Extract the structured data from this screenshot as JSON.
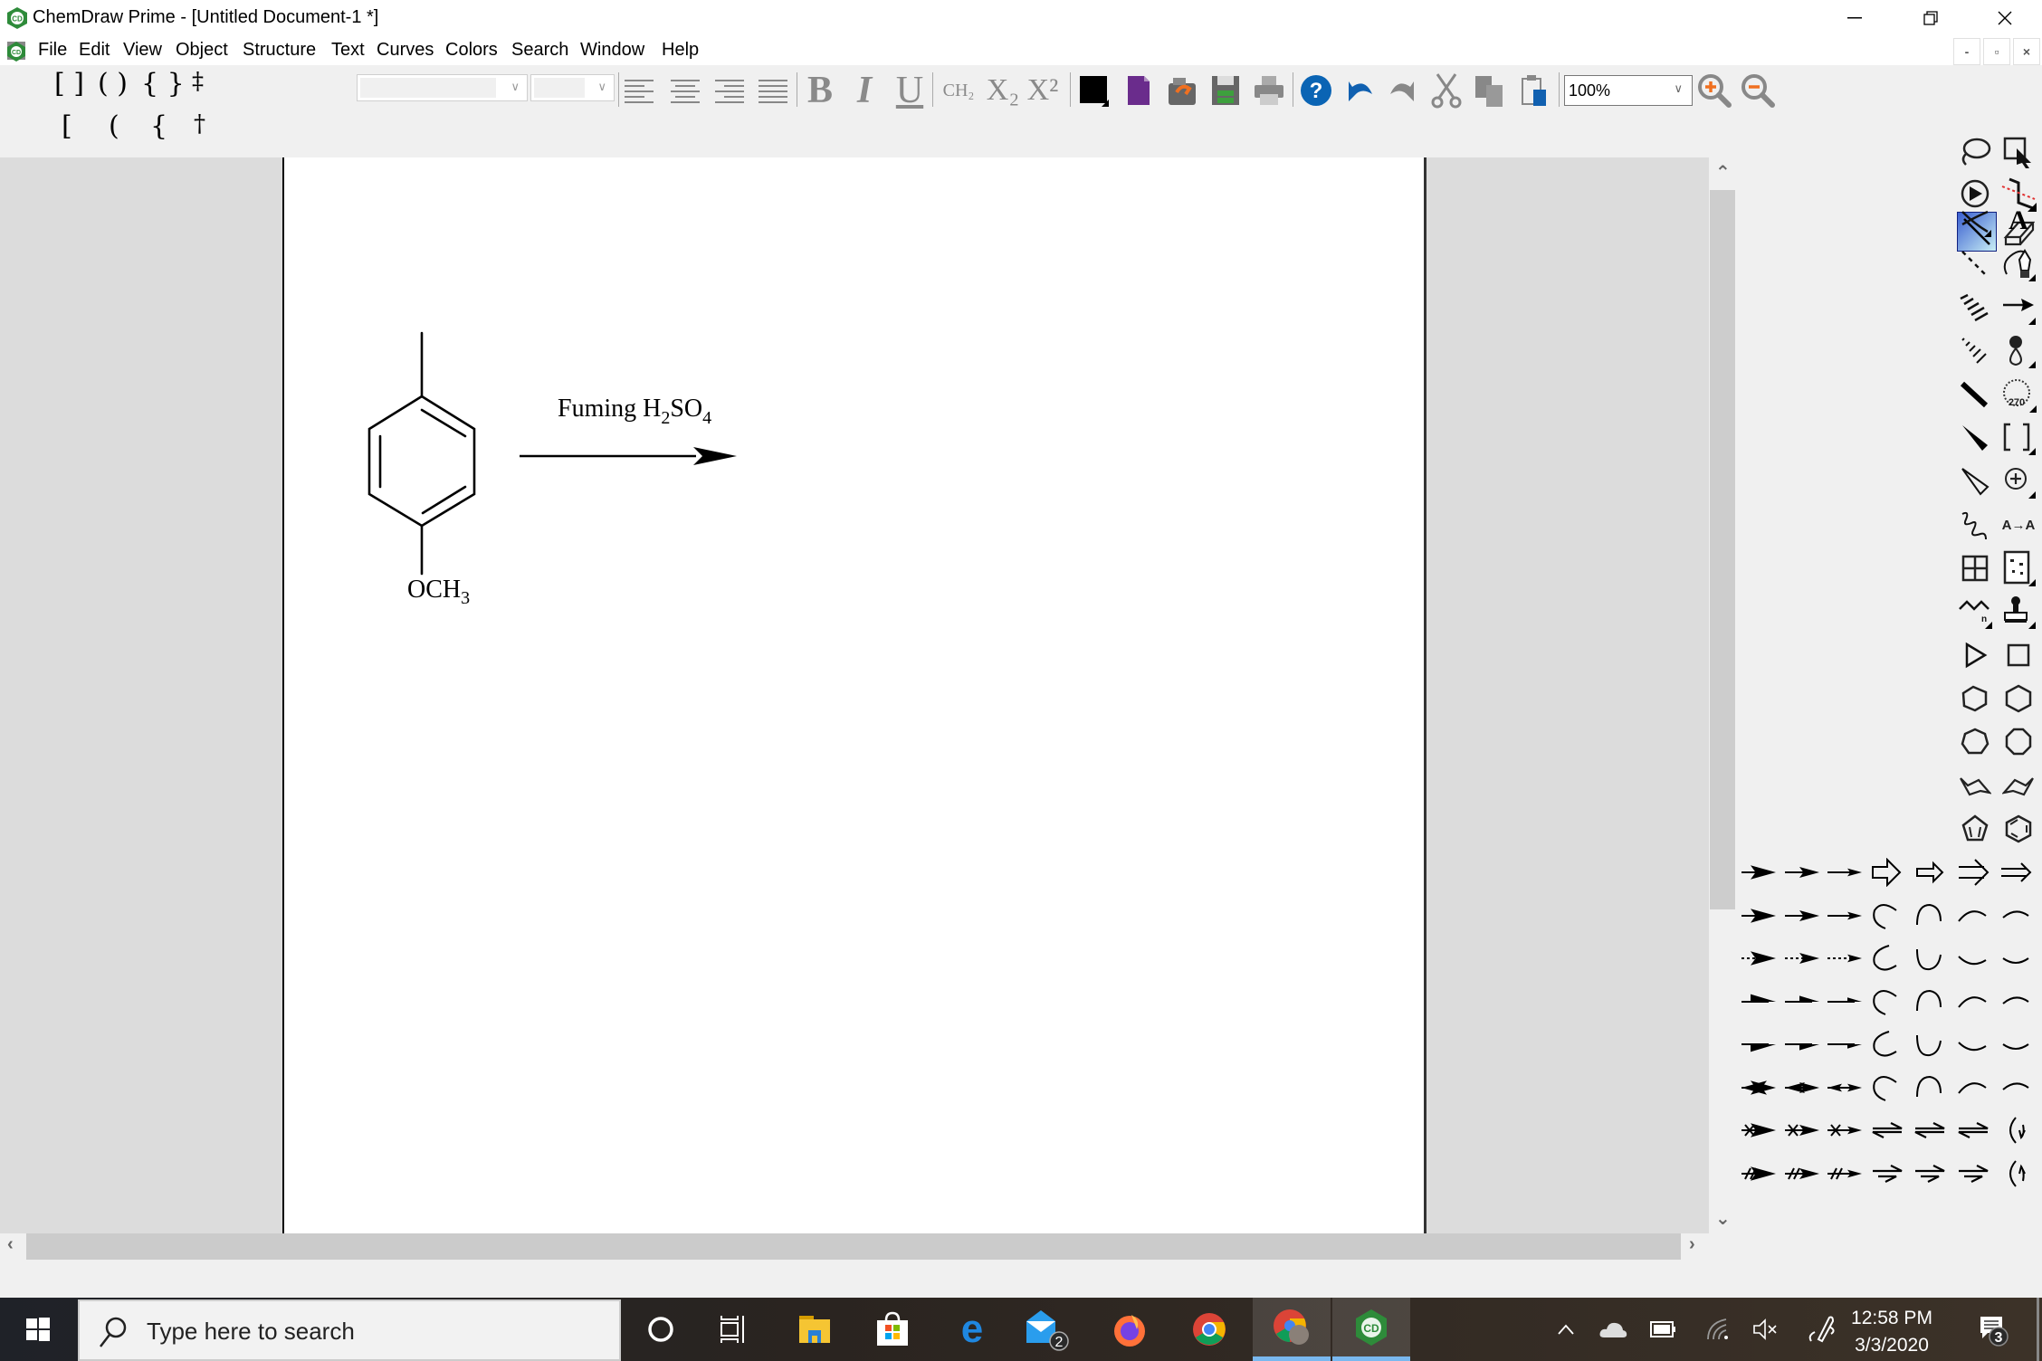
{
  "window": {
    "title": "ChemDraw Prime - [Untitled Document-1 *]",
    "controls": {
      "minimize": "minimize-icon",
      "restore": "restore-icon",
      "close": "close-icon"
    }
  },
  "menu": {
    "items": [
      "File",
      "Edit",
      "View",
      "Object",
      "Structure",
      "Text",
      "Curves",
      "Colors",
      "Search",
      "Window",
      "Help"
    ],
    "mdi_controls": [
      "-",
      "▫",
      "×"
    ]
  },
  "toolbar": {
    "brackets_row1": [
      "[ ]",
      "( )",
      "{ }",
      "‡"
    ],
    "brackets_row2": [
      "[",
      "(",
      "{",
      "†"
    ],
    "font_name": "",
    "font_size": "",
    "bold_label": "B",
    "italic_label": "I",
    "underline_label": "U",
    "formula_label": "CH₂",
    "subscript_label": "X₂",
    "superscript_label": "X²",
    "zoom_value": "100%",
    "colors": {
      "text_color": "#000000",
      "document_color": "#6a2c8c",
      "help_blue": "#0a64b4",
      "zoom_orange": "#f07020"
    }
  },
  "document": {
    "reaction": {
      "reactant": "4-methylanisole",
      "substituent_bottom": "OCH₃",
      "substituent_bottom_main": "OCH",
      "substituent_bottom_sub": "3",
      "reagent_text": "Fuming H₂SO₄",
      "reagent_parts": [
        "Fuming H",
        "2",
        "SO",
        "4"
      ]
    }
  },
  "palette": {
    "tools": [
      "lasso",
      "marquee",
      "structure-perspective",
      "mass-fragmentation",
      "solid-bond",
      "eraser",
      "crossed-bond",
      "text",
      "dashed-bond",
      "pen",
      "hashed-bond",
      "arrow",
      "hashed-wedge",
      "orbital",
      "bold-bond",
      "drawing-elements-270",
      "wedge-bond",
      "brackets",
      "hollow-wedge",
      "charge",
      "wavy-bond",
      "chemical-symbols",
      "table",
      "tlc-plate",
      "acyclic-chain",
      "template-stamp",
      "triangle",
      "square",
      "cyclopentane",
      "cyclohexane",
      "cycloheptane",
      "cyclooctane",
      "chair-left",
      "chair-right",
      "cyclopentadiene",
      "benzene"
    ],
    "charge_label": "270",
    "symbol_label": "A→A"
  },
  "taskbar": {
    "search_placeholder": "Type here to search",
    "mail_badge": "2",
    "notification_badge": "3",
    "time": "12:58 PM",
    "date": "3/3/2020"
  }
}
